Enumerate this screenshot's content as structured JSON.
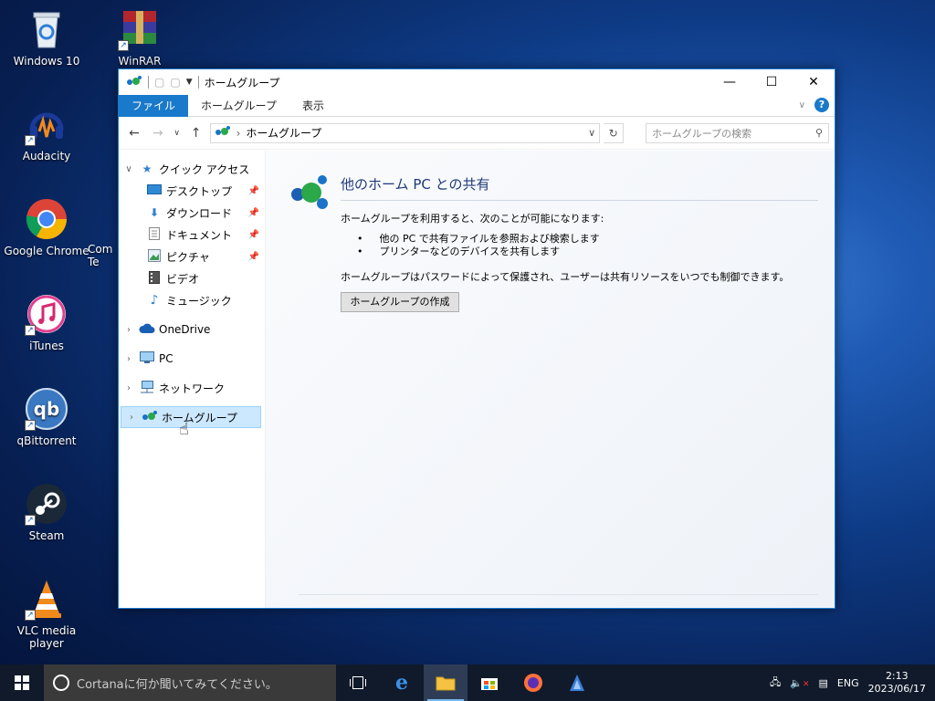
{
  "desktop": {
    "icons": [
      {
        "label": "Windows 10"
      },
      {
        "label": "WinRAR"
      },
      {
        "label": "Audacity"
      },
      {
        "label": "Google Chrome"
      },
      {
        "label": "Com Te"
      },
      {
        "label": "iTunes"
      },
      {
        "label": "qBittorrent"
      },
      {
        "label": "Steam"
      },
      {
        "label": "VLC media player"
      }
    ]
  },
  "window": {
    "title": "ホームグループ",
    "controls": {
      "minimize": "—",
      "maximize": "☐",
      "close": "✕"
    },
    "ribbon": {
      "tabs": [
        {
          "label": "ファイル",
          "active": true
        },
        {
          "label": "ホームグループ",
          "active": false
        },
        {
          "label": "表示",
          "active": false
        }
      ]
    },
    "address": {
      "path": "ホームグループ",
      "search_placeholder": "ホームグループの検索"
    },
    "sidebar": {
      "quick_access": "クイック アクセス",
      "items": [
        {
          "label": "デスクトップ",
          "pinned": true
        },
        {
          "label": "ダウンロード",
          "pinned": true
        },
        {
          "label": "ドキュメント",
          "pinned": true
        },
        {
          "label": "ピクチャ",
          "pinned": true
        },
        {
          "label": "ビデオ",
          "pinned": false
        },
        {
          "label": "ミュージック",
          "pinned": false
        }
      ],
      "roots": [
        {
          "label": "OneDrive"
        },
        {
          "label": "PC"
        },
        {
          "label": "ネットワーク"
        },
        {
          "label": "ホームグループ",
          "selected": true
        }
      ]
    },
    "content": {
      "heading": "他のホーム PC との共有",
      "description": "ホームグループを利用すると、次のことが可能になります:",
      "bullets": [
        "他の PC で共有ファイルを参照および検索します",
        "プリンターなどのデバイスを共有します"
      ],
      "note": "ホームグループはパスワードによって保護され、ユーザーは共有リソースをいつでも制御できます。",
      "create_button": "ホームグループの作成"
    }
  },
  "taskbar": {
    "cortana_placeholder": "Cortanaに何か聞いてみてください。",
    "language": "ENG",
    "time": "2:13",
    "date": "2023/06/17"
  },
  "colors": {
    "accent": "#1979ca",
    "selection": "#cce8ff",
    "heading": "#1e3a78"
  }
}
